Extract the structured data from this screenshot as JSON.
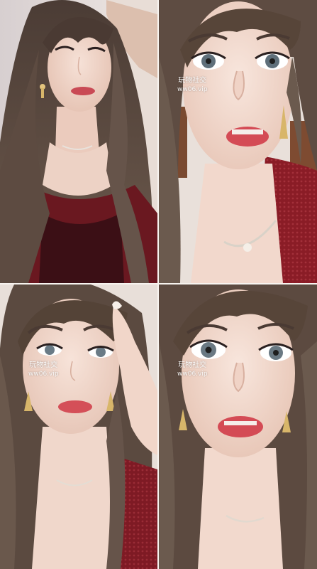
{
  "panels": [
    {
      "id": "top-left"
    },
    {
      "id": "top-right",
      "watermark": {
        "line1": "玩物社交",
        "line2": "ww06.vip"
      }
    },
    {
      "id": "bottom-left",
      "watermark": {
        "line1": "玩物社交",
        "line2": "ww06.vip"
      }
    },
    {
      "id": "bottom-right",
      "watermark": {
        "line1": "玩物社交",
        "line2": "ww06.vip"
      }
    }
  ],
  "colors": {
    "hair": "#5b4a40",
    "skin": "#f3dcd0",
    "lips": "#d9535a",
    "red_top": "#7a1d25",
    "wall": "#e9dfd8",
    "wood": "#7a4a30"
  }
}
